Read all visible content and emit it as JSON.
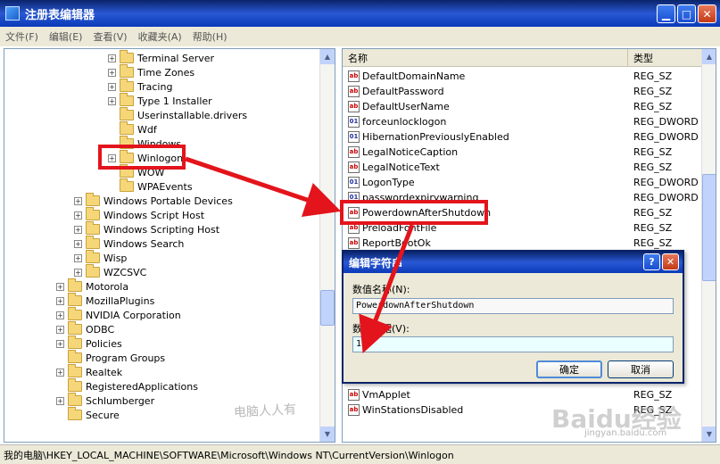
{
  "window": {
    "title": "注册表编辑器",
    "minimize": "▁",
    "maximize": "□",
    "close": "✕"
  },
  "menu": [
    "文件(F)",
    "编辑(E)",
    "查看(V)",
    "收藏夹(A)",
    "帮助(H)"
  ],
  "tree": [
    {
      "label": "Terminal Server",
      "expander": "+"
    },
    {
      "label": "Time Zones",
      "expander": "+"
    },
    {
      "label": "Tracing",
      "expander": "+"
    },
    {
      "label": "Type 1 Installer",
      "expander": "+"
    },
    {
      "label": "Userinstallable.drivers",
      "expander": ""
    },
    {
      "label": "Wdf",
      "expander": ""
    },
    {
      "label": "Windows",
      "expander": ""
    },
    {
      "label": "Winlogon",
      "expander": "+"
    },
    {
      "label": "WOW",
      "expander": ""
    },
    {
      "label": "WPAEvents",
      "expander": ""
    },
    {
      "label": "Windows Portable Devices",
      "expander": "+"
    },
    {
      "label": "Windows Script Host",
      "expander": "+"
    },
    {
      "label": "Windows Scripting Host",
      "expander": "+"
    },
    {
      "label": "Windows Search",
      "expander": "+"
    },
    {
      "label": "Wisp",
      "expander": "+"
    },
    {
      "label": "WZCSVC",
      "expander": "+"
    },
    {
      "label": "Motorola",
      "expander": "+"
    },
    {
      "label": "MozillaPlugins",
      "expander": "+"
    },
    {
      "label": "NVIDIA Corporation",
      "expander": "+"
    },
    {
      "label": "ODBC",
      "expander": "+"
    },
    {
      "label": "Policies",
      "expander": "+"
    },
    {
      "label": "Program Groups",
      "expander": ""
    },
    {
      "label": "Realtek",
      "expander": "+"
    },
    {
      "label": "RegisteredApplications",
      "expander": ""
    },
    {
      "label": "Schlumberger",
      "expander": "+"
    },
    {
      "label": "Secure",
      "expander": ""
    }
  ],
  "list": {
    "col_name": "名称",
    "col_type": "类型",
    "rows": [
      {
        "name": "DefaultDomainName",
        "type": "REG_SZ",
        "icon": "ab"
      },
      {
        "name": "DefaultPassword",
        "type": "REG_SZ",
        "icon": "ab"
      },
      {
        "name": "DefaultUserName",
        "type": "REG_SZ",
        "icon": "ab"
      },
      {
        "name": "forceunlocklogon",
        "type": "REG_DWORD",
        "icon": "01"
      },
      {
        "name": "HibernationPreviouslyEnabled",
        "type": "REG_DWORD",
        "icon": "01"
      },
      {
        "name": "LegalNoticeCaption",
        "type": "REG_SZ",
        "icon": "ab"
      },
      {
        "name": "LegalNoticeText",
        "type": "REG_SZ",
        "icon": "ab"
      },
      {
        "name": "LogonType",
        "type": "REG_DWORD",
        "icon": "01"
      },
      {
        "name": "passwordexpirywarning",
        "type": "REG_DWORD",
        "icon": "01"
      },
      {
        "name": "PowerdownAfterShutdown",
        "type": "REG_SZ",
        "icon": "ab"
      },
      {
        "name": "PreloadFontFile",
        "type": "REG_SZ",
        "icon": "ab"
      },
      {
        "name": "ReportBootOk",
        "type": "REG_SZ",
        "icon": "ab"
      },
      {
        "name": "VmApplet",
        "type": "REG_SZ",
        "icon": "ab"
      },
      {
        "name": "WinStationsDisabled",
        "type": "REG_SZ",
        "icon": "ab"
      }
    ]
  },
  "dialog": {
    "title": "编辑字符串",
    "help": "?",
    "close": "✕",
    "name_label": "数值名称(N):",
    "name_value": "PowerdownAfterShutdown",
    "data_label": "数值数据(V):",
    "data_value": "1",
    "ok": "确定",
    "cancel": "取消"
  },
  "status": "我的电脑\\HKEY_LOCAL_MACHINE\\SOFTWARE\\Microsoft\\Windows NT\\CurrentVersion\\Winlogon",
  "watermark": {
    "signature": "电脑人人有",
    "baidu": "Baidu经验",
    "baidu_url": "jingyan.baidu.com"
  },
  "colors": {
    "highlight": "#e3141b",
    "titlebar": "#0a246a"
  }
}
